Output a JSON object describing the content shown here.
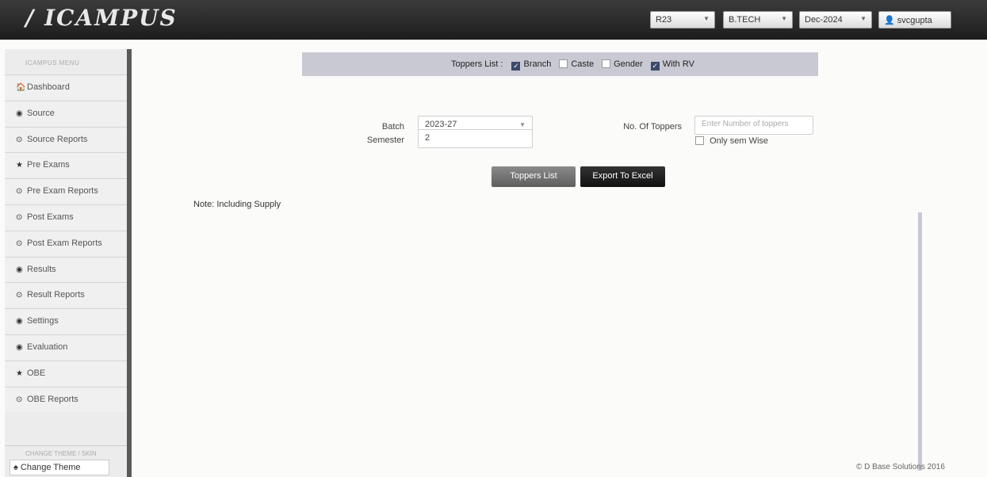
{
  "app": {
    "logo": "ICAMPUS",
    "logo_mark": "/"
  },
  "topbar": {
    "regulation": "R23",
    "program": "B.TECH",
    "session": "Dec-2024",
    "user": "svcgupta",
    "user_icon": "user-icon"
  },
  "sidebar": {
    "heading": "ICAMPUS MENU",
    "items": [
      {
        "label": "Dashboard",
        "icon": "home-icon",
        "glyph": "🏠"
      },
      {
        "label": "Source",
        "icon": "eye-icon",
        "glyph": "◉"
      },
      {
        "label": "Source Reports",
        "icon": "clock-icon",
        "glyph": "⊙"
      },
      {
        "label": "Pre Exams",
        "icon": "star-icon",
        "glyph": "★"
      },
      {
        "label": "Pre Exam Reports",
        "icon": "clock-icon",
        "glyph": "⊙"
      },
      {
        "label": "Post Exams",
        "icon": "clock-icon",
        "glyph": "⊙"
      },
      {
        "label": "Post Exam Reports",
        "icon": "clock-icon",
        "glyph": "⊙"
      },
      {
        "label": "Results",
        "icon": "eye-icon",
        "glyph": "◉"
      },
      {
        "label": "Result Reports",
        "icon": "clock-icon",
        "glyph": "⊙"
      },
      {
        "label": "Settings",
        "icon": "eye-icon",
        "glyph": "◉"
      },
      {
        "label": "Evaluation",
        "icon": "eye-icon",
        "glyph": "◉"
      },
      {
        "label": "OBE",
        "icon": "star-icon",
        "glyph": "★"
      },
      {
        "label": "OBE Reports",
        "icon": "clock-icon",
        "glyph": "⊙"
      }
    ],
    "theme_heading": "CHANGE THEME / SKIN",
    "theme_button": "Change Theme"
  },
  "toppers": {
    "title": "Toppers List :",
    "options": [
      {
        "label": "Branch",
        "checked": true
      },
      {
        "label": "Caste",
        "checked": false
      },
      {
        "label": "Gender",
        "checked": false
      },
      {
        "label": "With RV",
        "checked": true
      }
    ]
  },
  "form": {
    "batch_label": "Batch",
    "batch_value": "2023-27",
    "toppers_label": "No. Of Toppers",
    "toppers_placeholder": "Enter Number of toppers",
    "semester_label": "Semester",
    "semester_value": "2",
    "sem_wise_label": "Only sem Wise",
    "sem_wise_checked": false
  },
  "buttons": {
    "toppers_list": "Toppers List",
    "export_excel": "Export To Excel"
  },
  "note": "Note: Including Supply",
  "footer": "© D Base Solutions 2016"
}
